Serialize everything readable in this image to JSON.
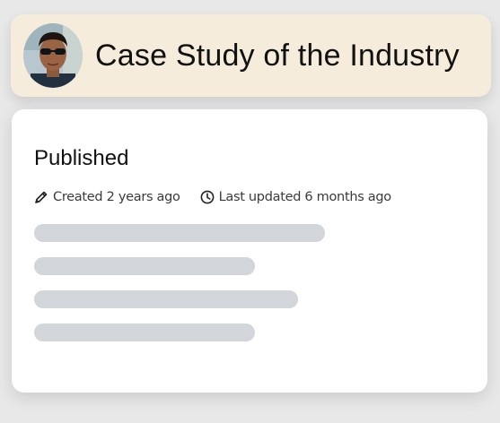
{
  "header": {
    "title": "Case Study of the Industry"
  },
  "status": {
    "heading": "Published"
  },
  "meta": {
    "created_icon": "pencil-icon",
    "created_text": "Created 2 years ago",
    "updated_icon": "clock-icon",
    "updated_text": "Last updated 6 months ago"
  },
  "colors": {
    "header_bg": "#f6ecdc",
    "card_bg": "#ffffff",
    "skeleton": "#d2d5d9",
    "page_bg": "#e8e8e9"
  }
}
